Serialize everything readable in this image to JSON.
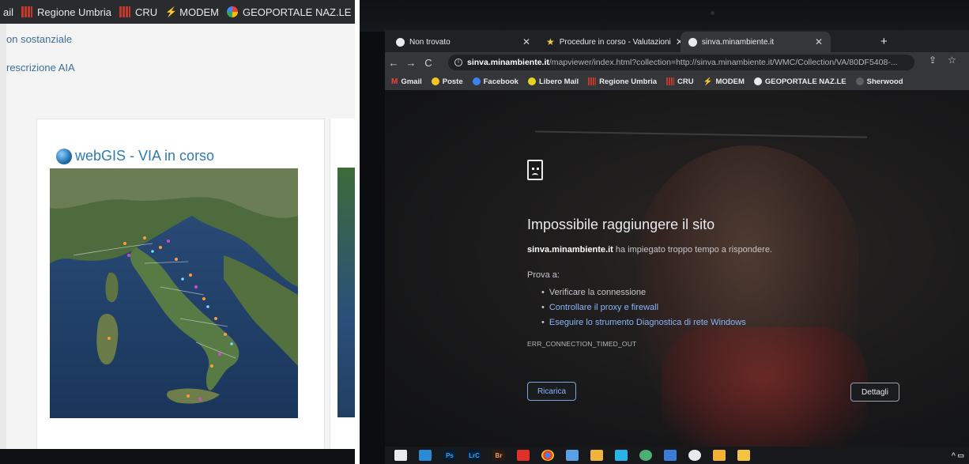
{
  "left_photo": {
    "bookmarks": [
      {
        "label": "ail",
        "icon": "none"
      },
      {
        "label": "Regione Umbria",
        "icon": "grid-icon"
      },
      {
        "label": "CRU",
        "icon": "grid-icon"
      },
      {
        "label": "MODEM",
        "icon": "plug-icon"
      },
      {
        "label": "GEOPORTALE NAZ.LE",
        "icon": "google-icon"
      }
    ],
    "links": [
      "on sostanziale",
      "rescrizione AIA"
    ],
    "card_title": "webGIS - VIA in corso"
  },
  "browser": {
    "tabs": [
      {
        "title": "Non trovato",
        "icon": "globe-icon"
      },
      {
        "title": "Procedure in corso - Valutazioni",
        "icon": "star-icon"
      },
      {
        "title": "sinva.minambiente.it",
        "icon": "globe-icon"
      }
    ],
    "url_host": "sinva.minambiente.it",
    "url_rest": "/mapviewer/index.html?collection=http://sinva.minambiente.it/WMC/Collection/VA/80DF5408-...",
    "bookmarks": [
      {
        "label": "Gmail",
        "icon": "gmail-icon"
      },
      {
        "label": "Poste",
        "icon": "poste-icon"
      },
      {
        "label": "Facebook",
        "icon": "facebook-icon"
      },
      {
        "label": "Libero Mail",
        "icon": "libero-icon"
      },
      {
        "label": "Regione Umbria",
        "icon": "grid-icon"
      },
      {
        "label": "CRU",
        "icon": "grid-icon"
      },
      {
        "label": "MODEM",
        "icon": "plug-icon"
      },
      {
        "label": "GEOPORTALE NAZ.LE",
        "icon": "google-icon"
      },
      {
        "label": "Sherwood",
        "icon": "folder-icon"
      }
    ]
  },
  "error_page": {
    "title": "Impossibile raggiungere il sito",
    "host": "sinva.minambiente.it",
    "subtitle_rest": " ha impiegato troppo tempo a rispondere.",
    "try_label": "Prova a:",
    "suggestions": [
      {
        "prefix": "Verificare la connessione",
        "link": ""
      },
      {
        "prefix": "",
        "link": "Controllare il proxy e firewall"
      },
      {
        "prefix": "",
        "link": "Eseguire lo strumento Diagnostica di rete Windows"
      }
    ],
    "error_code": "ERR_CONNECTION_TIMED_OUT",
    "reload_label": "Ricarica",
    "details_label": "Dettagli"
  },
  "taskbar": {
    "apps": [
      "Ps",
      "LrC",
      "Br"
    ]
  },
  "colors": {
    "link_blue": "#8ab4f8",
    "chrome_dark": "#35363a",
    "webgis_blue": "#2f7ab0"
  }
}
